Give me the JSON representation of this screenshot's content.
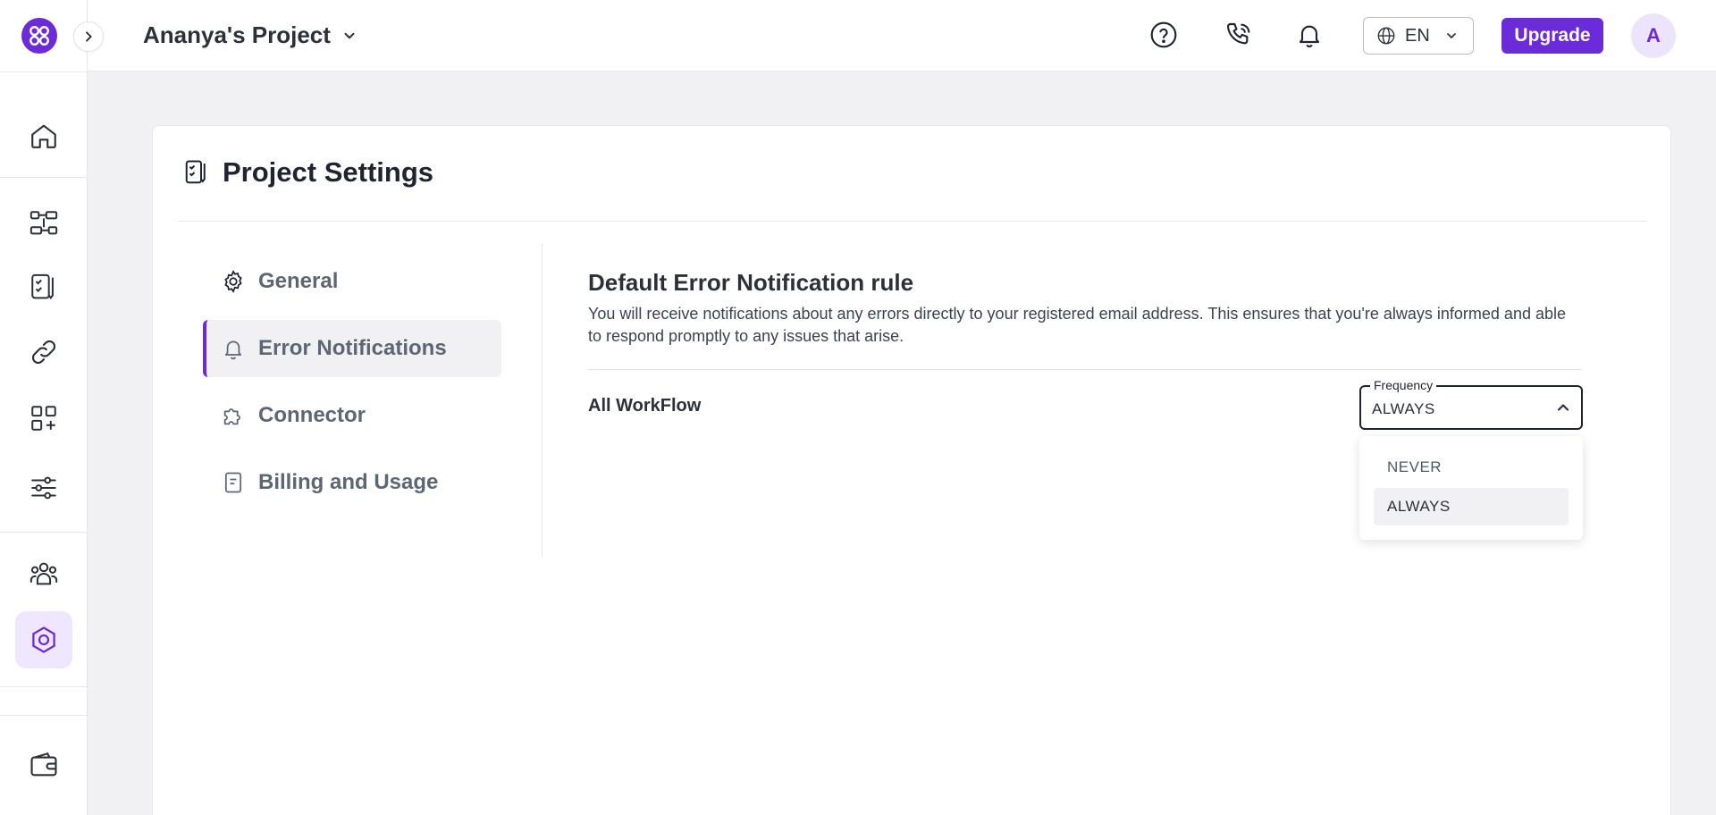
{
  "header": {
    "project_name": "Ananya's Project",
    "language": "EN",
    "upgrade_label": "Upgrade",
    "avatar_initial": "A"
  },
  "sidebar": {
    "items": [
      {
        "icon": "home-icon"
      },
      {
        "icon": "workflow-icon"
      },
      {
        "icon": "project-settings-icon"
      },
      {
        "icon": "link-icon"
      },
      {
        "icon": "apps-add-icon"
      },
      {
        "icon": "sliders-icon"
      },
      {
        "icon": "team-icon"
      },
      {
        "icon": "hexagon-settings-icon",
        "active": true
      },
      {
        "icon": "wallet-icon"
      }
    ]
  },
  "page": {
    "title": "Project Settings"
  },
  "settings_nav": {
    "items": [
      {
        "label": "General",
        "icon": "gear-icon"
      },
      {
        "label": "Error Notifications",
        "icon": "bell-icon",
        "active": true
      },
      {
        "label": "Connector",
        "icon": "puzzle-icon"
      },
      {
        "label": "Billing and Usage",
        "icon": "receipt-icon"
      }
    ]
  },
  "content": {
    "title": "Default Error Notification rule",
    "description": "You will receive notifications about any errors directly to your registered email address. This ensures that you're always informed and able to respond promptly to any issues that arise.",
    "row_label": "All WorkFlow",
    "frequency": {
      "legend": "Frequency",
      "value": "ALWAYS",
      "options": [
        "NEVER",
        "ALWAYS"
      ]
    }
  },
  "colors": {
    "accent": "#6c2bd9",
    "accent_light": "#efe6ff"
  }
}
